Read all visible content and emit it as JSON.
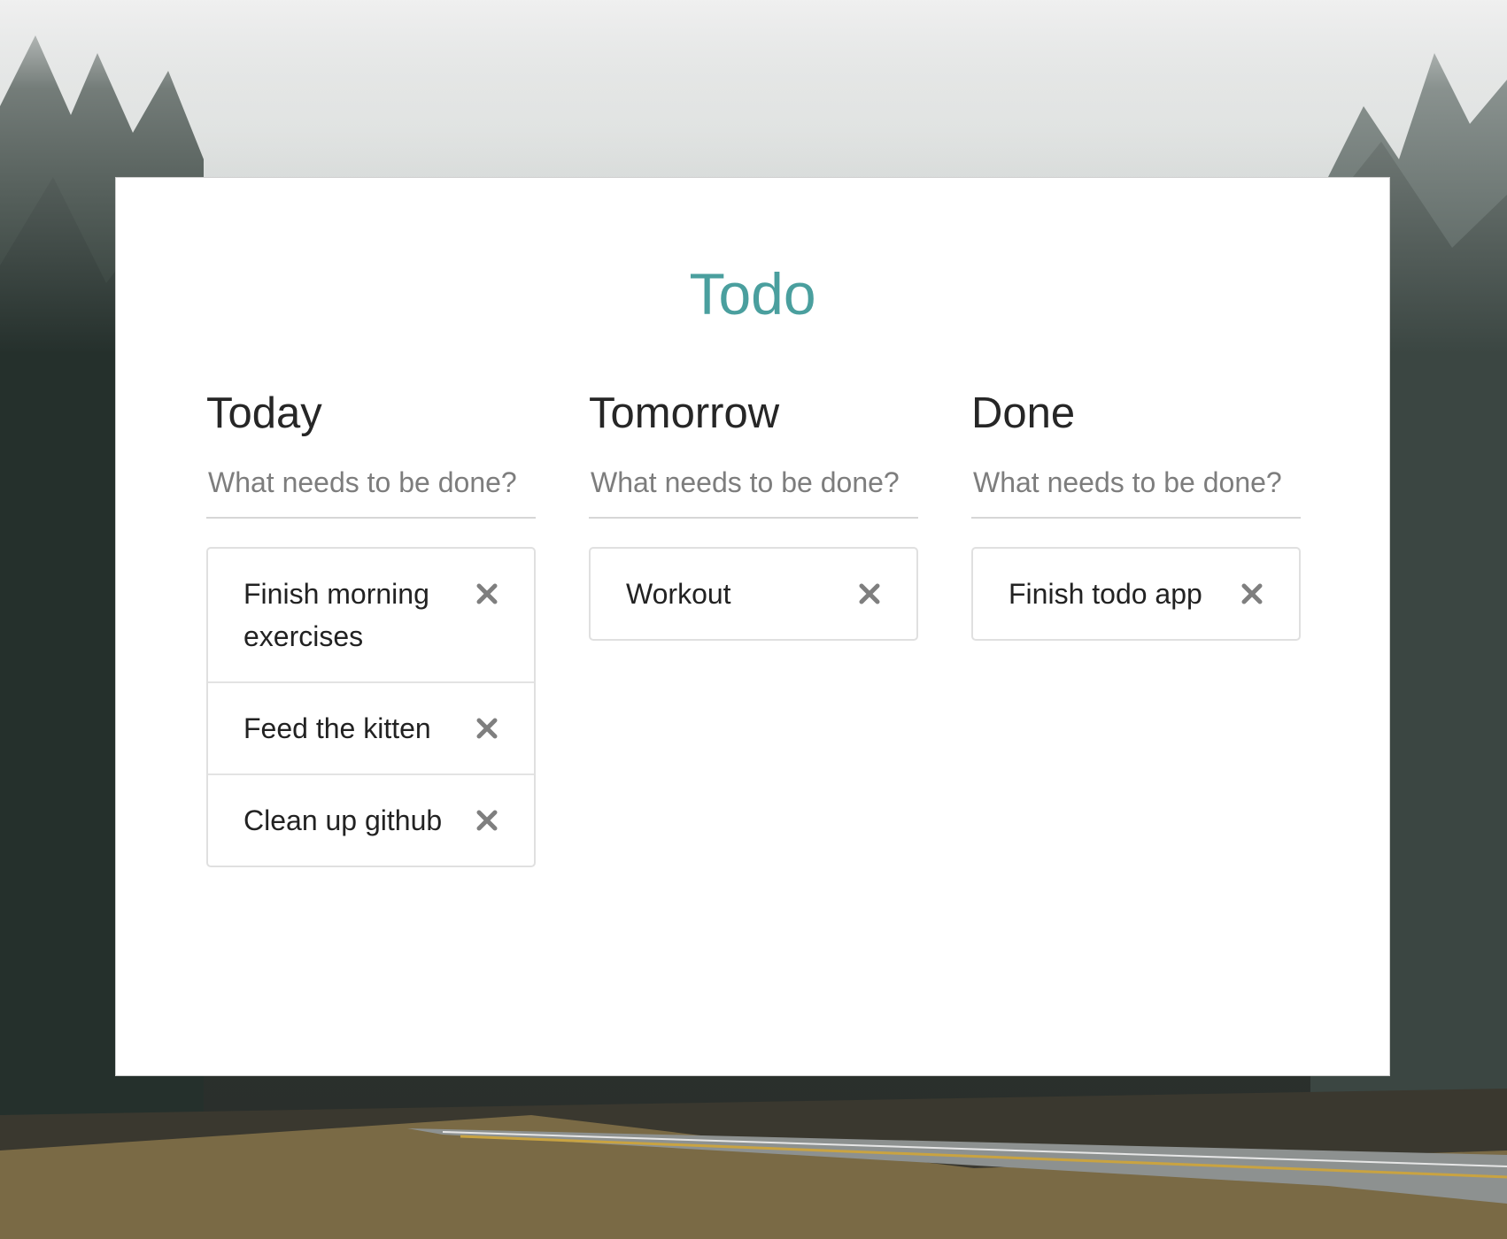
{
  "app": {
    "title": "Todo"
  },
  "colors": {
    "accent": "#4a9f9e",
    "delete_icon": "#7f7f7f",
    "card_background": "#ffffff"
  },
  "columns": [
    {
      "title": "Today",
      "input_placeholder": "What needs to be done?",
      "input_value": "",
      "items": [
        {
          "text": "Finish morning exercises",
          "delete_icon": "close-icon"
        },
        {
          "text": "Feed the kitten",
          "delete_icon": "close-icon"
        },
        {
          "text": "Clean up github",
          "delete_icon": "close-icon"
        }
      ]
    },
    {
      "title": "Tomorrow",
      "input_placeholder": "What needs to be done?",
      "input_value": "",
      "items": [
        {
          "text": "Workout",
          "delete_icon": "close-icon"
        }
      ]
    },
    {
      "title": "Done",
      "input_placeholder": "What needs to be done?",
      "input_value": "",
      "items": [
        {
          "text": "Finish todo app",
          "delete_icon": "close-icon"
        }
      ]
    }
  ]
}
